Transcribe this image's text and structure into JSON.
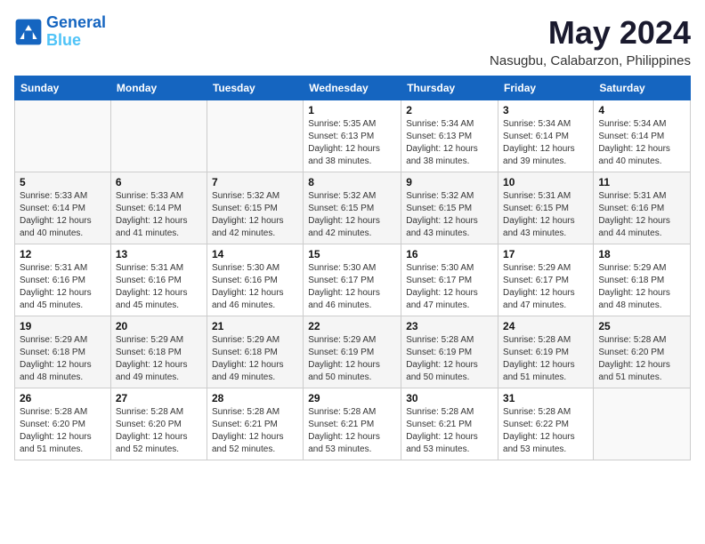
{
  "logo": {
    "line1": "General",
    "line2": "Blue"
  },
  "title": "May 2024",
  "subtitle": "Nasugbu, Calabarzon, Philippines",
  "days_header": [
    "Sunday",
    "Monday",
    "Tuesday",
    "Wednesday",
    "Thursday",
    "Friday",
    "Saturday"
  ],
  "weeks": [
    [
      {
        "day": "",
        "sunrise": "",
        "sunset": "",
        "daylight": ""
      },
      {
        "day": "",
        "sunrise": "",
        "sunset": "",
        "daylight": ""
      },
      {
        "day": "",
        "sunrise": "",
        "sunset": "",
        "daylight": ""
      },
      {
        "day": "1",
        "sunrise": "Sunrise: 5:35 AM",
        "sunset": "Sunset: 6:13 PM",
        "daylight": "Daylight: 12 hours and 38 minutes."
      },
      {
        "day": "2",
        "sunrise": "Sunrise: 5:34 AM",
        "sunset": "Sunset: 6:13 PM",
        "daylight": "Daylight: 12 hours and 38 minutes."
      },
      {
        "day": "3",
        "sunrise": "Sunrise: 5:34 AM",
        "sunset": "Sunset: 6:14 PM",
        "daylight": "Daylight: 12 hours and 39 minutes."
      },
      {
        "day": "4",
        "sunrise": "Sunrise: 5:34 AM",
        "sunset": "Sunset: 6:14 PM",
        "daylight": "Daylight: 12 hours and 40 minutes."
      }
    ],
    [
      {
        "day": "5",
        "sunrise": "Sunrise: 5:33 AM",
        "sunset": "Sunset: 6:14 PM",
        "daylight": "Daylight: 12 hours and 40 minutes."
      },
      {
        "day": "6",
        "sunrise": "Sunrise: 5:33 AM",
        "sunset": "Sunset: 6:14 PM",
        "daylight": "Daylight: 12 hours and 41 minutes."
      },
      {
        "day": "7",
        "sunrise": "Sunrise: 5:32 AM",
        "sunset": "Sunset: 6:15 PM",
        "daylight": "Daylight: 12 hours and 42 minutes."
      },
      {
        "day": "8",
        "sunrise": "Sunrise: 5:32 AM",
        "sunset": "Sunset: 6:15 PM",
        "daylight": "Daylight: 12 hours and 42 minutes."
      },
      {
        "day": "9",
        "sunrise": "Sunrise: 5:32 AM",
        "sunset": "Sunset: 6:15 PM",
        "daylight": "Daylight: 12 hours and 43 minutes."
      },
      {
        "day": "10",
        "sunrise": "Sunrise: 5:31 AM",
        "sunset": "Sunset: 6:15 PM",
        "daylight": "Daylight: 12 hours and 43 minutes."
      },
      {
        "day": "11",
        "sunrise": "Sunrise: 5:31 AM",
        "sunset": "Sunset: 6:16 PM",
        "daylight": "Daylight: 12 hours and 44 minutes."
      }
    ],
    [
      {
        "day": "12",
        "sunrise": "Sunrise: 5:31 AM",
        "sunset": "Sunset: 6:16 PM",
        "daylight": "Daylight: 12 hours and 45 minutes."
      },
      {
        "day": "13",
        "sunrise": "Sunrise: 5:31 AM",
        "sunset": "Sunset: 6:16 PM",
        "daylight": "Daylight: 12 hours and 45 minutes."
      },
      {
        "day": "14",
        "sunrise": "Sunrise: 5:30 AM",
        "sunset": "Sunset: 6:16 PM",
        "daylight": "Daylight: 12 hours and 46 minutes."
      },
      {
        "day": "15",
        "sunrise": "Sunrise: 5:30 AM",
        "sunset": "Sunset: 6:17 PM",
        "daylight": "Daylight: 12 hours and 46 minutes."
      },
      {
        "day": "16",
        "sunrise": "Sunrise: 5:30 AM",
        "sunset": "Sunset: 6:17 PM",
        "daylight": "Daylight: 12 hours and 47 minutes."
      },
      {
        "day": "17",
        "sunrise": "Sunrise: 5:29 AM",
        "sunset": "Sunset: 6:17 PM",
        "daylight": "Daylight: 12 hours and 47 minutes."
      },
      {
        "day": "18",
        "sunrise": "Sunrise: 5:29 AM",
        "sunset": "Sunset: 6:18 PM",
        "daylight": "Daylight: 12 hours and 48 minutes."
      }
    ],
    [
      {
        "day": "19",
        "sunrise": "Sunrise: 5:29 AM",
        "sunset": "Sunset: 6:18 PM",
        "daylight": "Daylight: 12 hours and 48 minutes."
      },
      {
        "day": "20",
        "sunrise": "Sunrise: 5:29 AM",
        "sunset": "Sunset: 6:18 PM",
        "daylight": "Daylight: 12 hours and 49 minutes."
      },
      {
        "day": "21",
        "sunrise": "Sunrise: 5:29 AM",
        "sunset": "Sunset: 6:18 PM",
        "daylight": "Daylight: 12 hours and 49 minutes."
      },
      {
        "day": "22",
        "sunrise": "Sunrise: 5:29 AM",
        "sunset": "Sunset: 6:19 PM",
        "daylight": "Daylight: 12 hours and 50 minutes."
      },
      {
        "day": "23",
        "sunrise": "Sunrise: 5:28 AM",
        "sunset": "Sunset: 6:19 PM",
        "daylight": "Daylight: 12 hours and 50 minutes."
      },
      {
        "day": "24",
        "sunrise": "Sunrise: 5:28 AM",
        "sunset": "Sunset: 6:19 PM",
        "daylight": "Daylight: 12 hours and 51 minutes."
      },
      {
        "day": "25",
        "sunrise": "Sunrise: 5:28 AM",
        "sunset": "Sunset: 6:20 PM",
        "daylight": "Daylight: 12 hours and 51 minutes."
      }
    ],
    [
      {
        "day": "26",
        "sunrise": "Sunrise: 5:28 AM",
        "sunset": "Sunset: 6:20 PM",
        "daylight": "Daylight: 12 hours and 51 minutes."
      },
      {
        "day": "27",
        "sunrise": "Sunrise: 5:28 AM",
        "sunset": "Sunset: 6:20 PM",
        "daylight": "Daylight: 12 hours and 52 minutes."
      },
      {
        "day": "28",
        "sunrise": "Sunrise: 5:28 AM",
        "sunset": "Sunset: 6:21 PM",
        "daylight": "Daylight: 12 hours and 52 minutes."
      },
      {
        "day": "29",
        "sunrise": "Sunrise: 5:28 AM",
        "sunset": "Sunset: 6:21 PM",
        "daylight": "Daylight: 12 hours and 53 minutes."
      },
      {
        "day": "30",
        "sunrise": "Sunrise: 5:28 AM",
        "sunset": "Sunset: 6:21 PM",
        "daylight": "Daylight: 12 hours and 53 minutes."
      },
      {
        "day": "31",
        "sunrise": "Sunrise: 5:28 AM",
        "sunset": "Sunset: 6:22 PM",
        "daylight": "Daylight: 12 hours and 53 minutes."
      },
      {
        "day": "",
        "sunrise": "",
        "sunset": "",
        "daylight": ""
      }
    ]
  ]
}
